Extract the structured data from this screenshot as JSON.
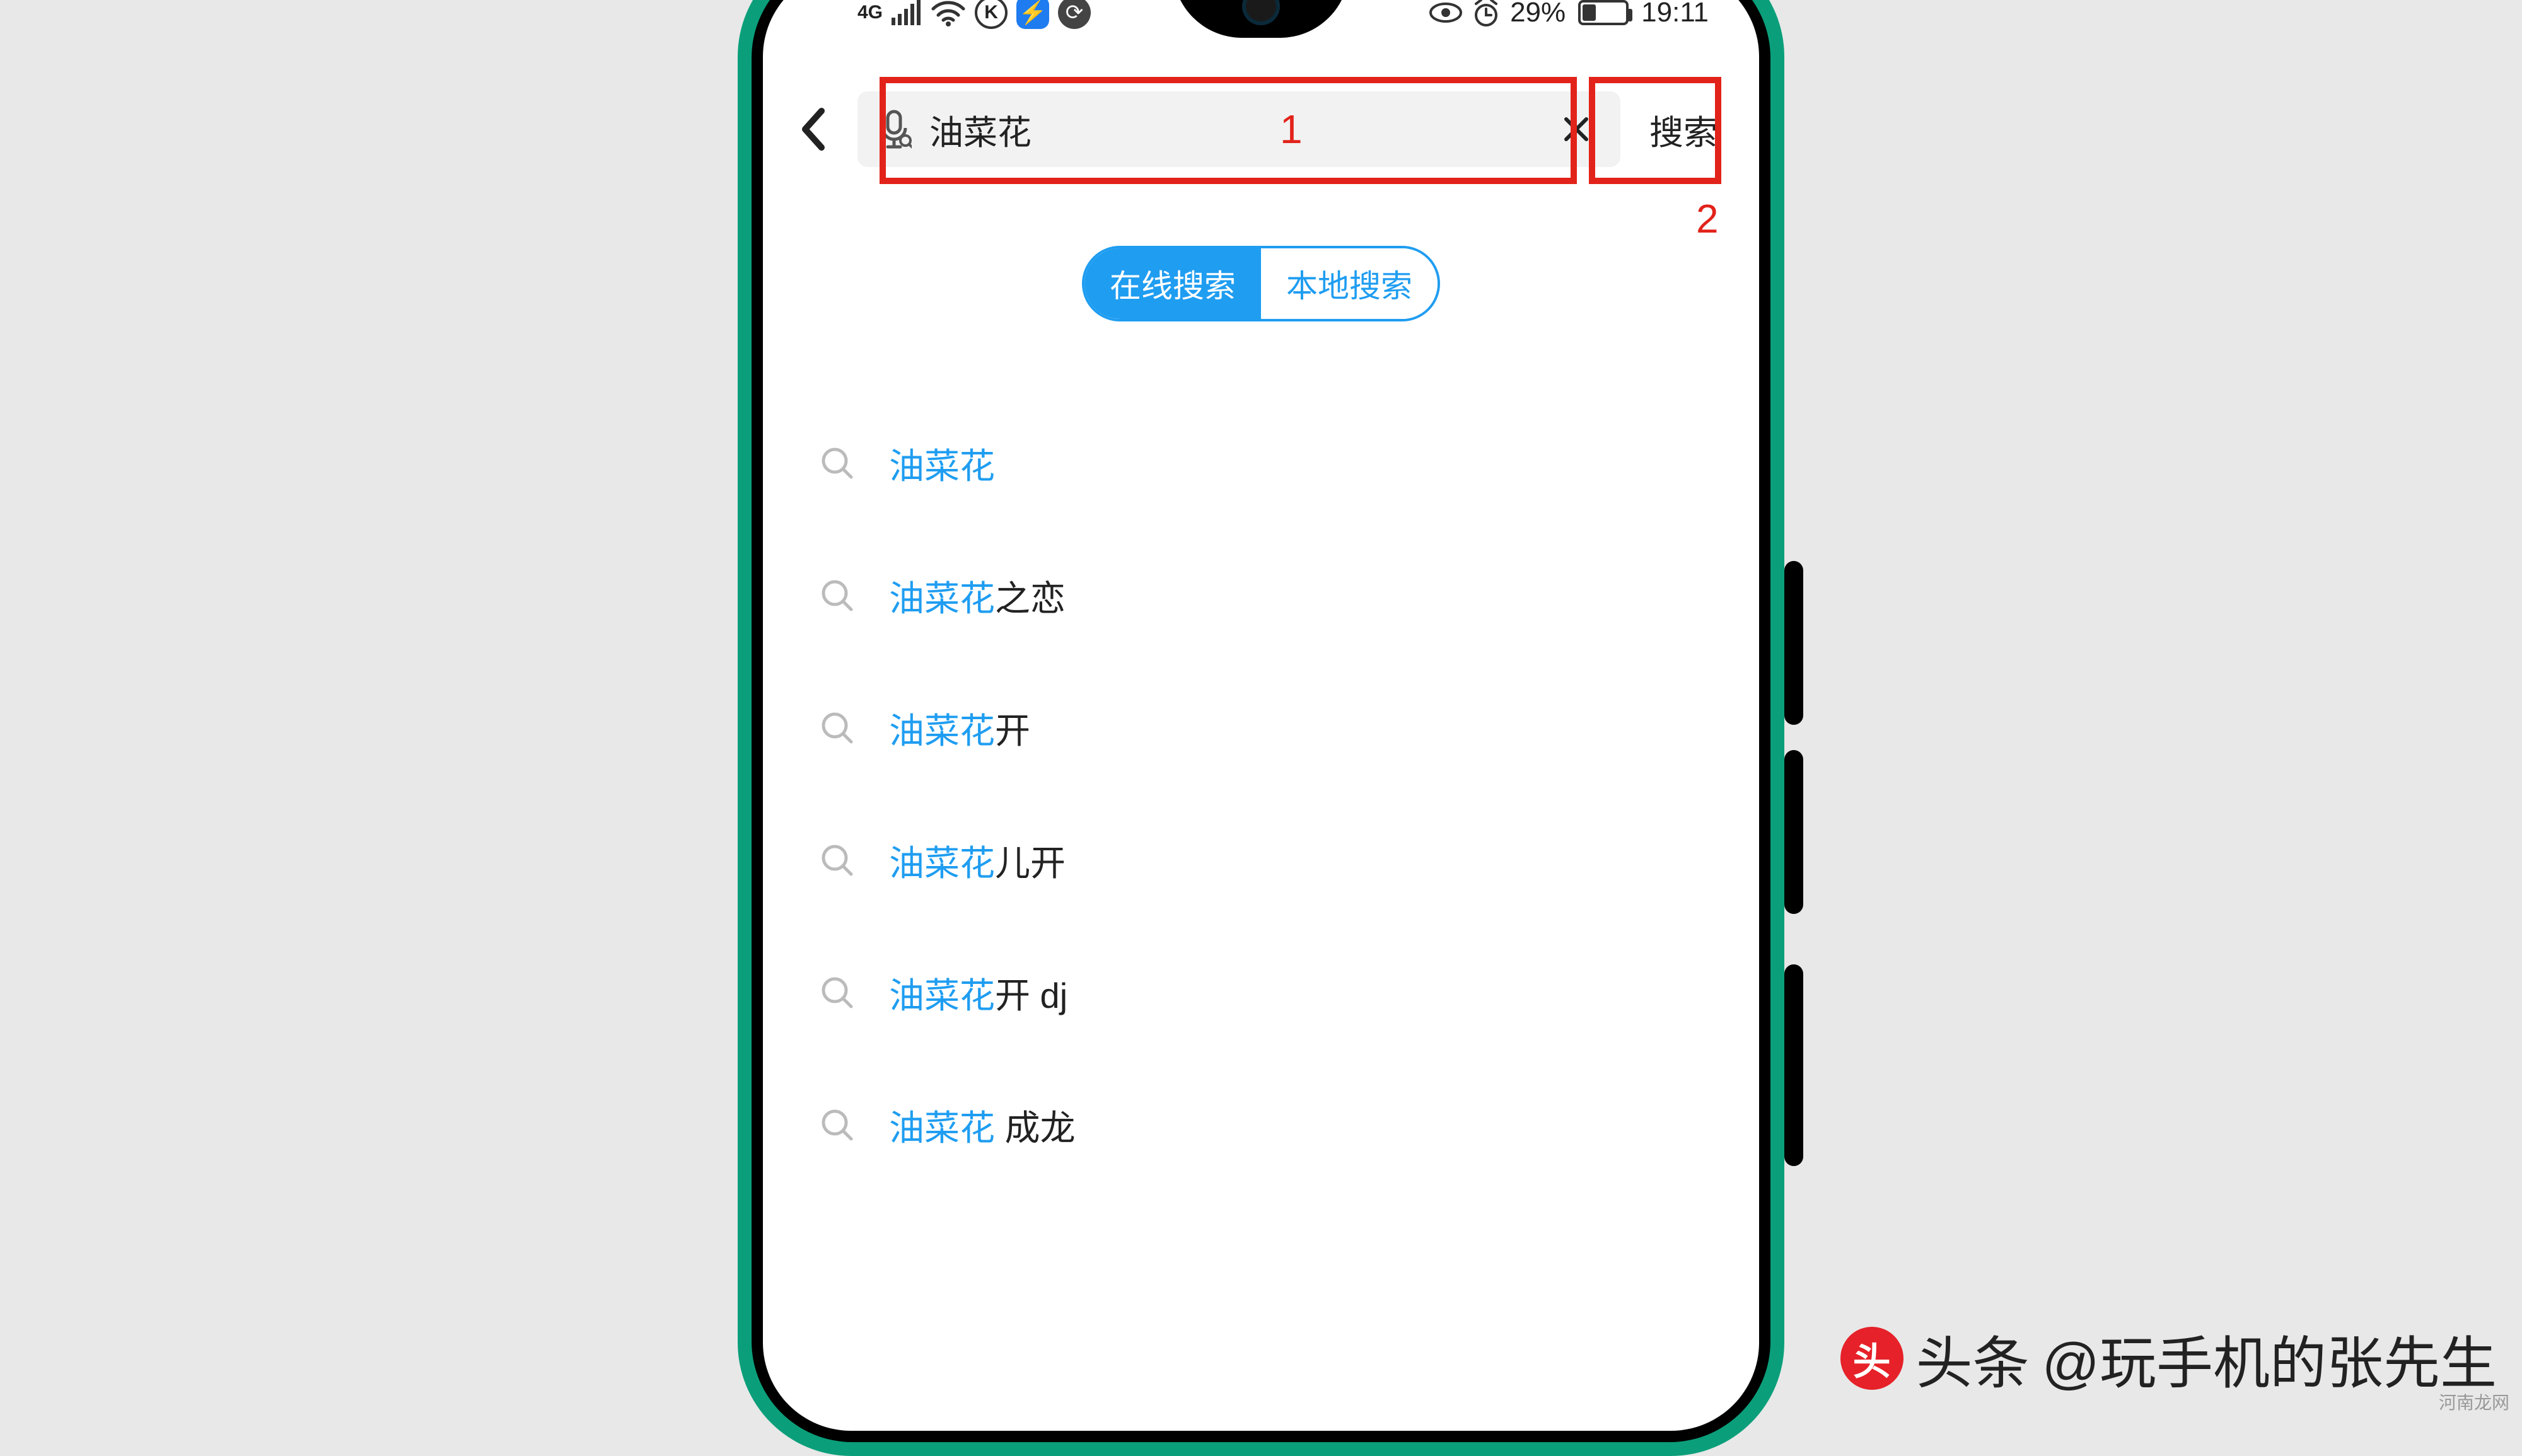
{
  "status": {
    "network_label": "4G",
    "k_badge": "K",
    "battery_percent": "29%",
    "time": "19:11"
  },
  "search": {
    "query": "油菜花",
    "button_label": "搜索"
  },
  "annotations": {
    "box1_label": "1",
    "box2_label": "2"
  },
  "tabs": {
    "online": "在线搜索",
    "local": "本地搜索"
  },
  "suggestions": [
    {
      "highlight": "油菜花",
      "rest": ""
    },
    {
      "highlight": "油菜花",
      "rest": "之恋"
    },
    {
      "highlight": "油菜花",
      "rest": "开"
    },
    {
      "highlight": "油菜花",
      "rest": "儿开"
    },
    {
      "highlight": "油菜花",
      "rest": "开 dj"
    },
    {
      "highlight": "油菜花",
      "rest": " 成龙"
    }
  ],
  "credit": {
    "prefix": "头条",
    "handle": "@玩手机的张先生"
  },
  "site_mark": "河南龙网"
}
